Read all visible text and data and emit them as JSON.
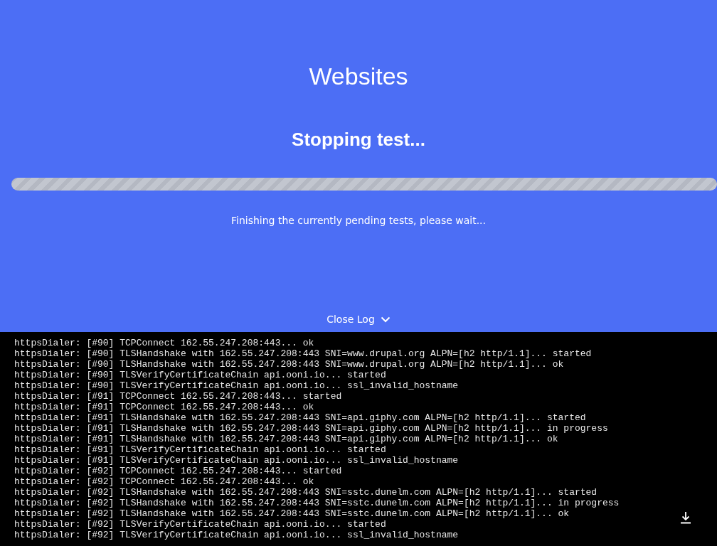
{
  "header": {
    "title": "Websites",
    "status": "Stopping test...",
    "message": "Finishing the currently pending tests, please wait...",
    "log_toggle": "Close Log",
    "progress": {
      "level": 1
    }
  },
  "log": {
    "lines": [
      "httpsDialer: [#90] TCPConnect 162.55.247.208:443... ok",
      "httpsDialer: [#90] TLSHandshake with 162.55.247.208:443 SNI=www.drupal.org ALPN=[h2 http/1.1]... started",
      "httpsDialer: [#90] TLSHandshake with 162.55.247.208:443 SNI=www.drupal.org ALPN=[h2 http/1.1]... ok",
      "httpsDialer: [#90] TLSVerifyCertificateChain api.ooni.io... started",
      "httpsDialer: [#90] TLSVerifyCertificateChain api.ooni.io... ssl_invalid_hostname",
      "httpsDialer: [#91] TCPConnect 162.55.247.208:443... started",
      "httpsDialer: [#91] TCPConnect 162.55.247.208:443... ok",
      "httpsDialer: [#91] TLSHandshake with 162.55.247.208:443 SNI=api.giphy.com ALPN=[h2 http/1.1]... started",
      "httpsDialer: [#91] TLSHandshake with 162.55.247.208:443 SNI=api.giphy.com ALPN=[h2 http/1.1]... in progress",
      "httpsDialer: [#91] TLSHandshake with 162.55.247.208:443 SNI=api.giphy.com ALPN=[h2 http/1.1]... ok",
      "httpsDialer: [#91] TLSVerifyCertificateChain api.ooni.io... started",
      "httpsDialer: [#91] TLSVerifyCertificateChain api.ooni.io... ssl_invalid_hostname",
      "httpsDialer: [#92] TCPConnect 162.55.247.208:443... started",
      "httpsDialer: [#92] TCPConnect 162.55.247.208:443... ok",
      "httpsDialer: [#92] TLSHandshake with 162.55.247.208:443 SNI=sstc.dunelm.com ALPN=[h2 http/1.1]... started",
      "httpsDialer: [#92] TLSHandshake with 162.55.247.208:443 SNI=sstc.dunelm.com ALPN=[h2 http/1.1]... in progress",
      "httpsDialer: [#92] TLSHandshake with 162.55.247.208:443 SNI=sstc.dunelm.com ALPN=[h2 http/1.1]... ok",
      "httpsDialer: [#92] TLSVerifyCertificateChain api.ooni.io... started",
      "httpsDialer: [#92] TLSVerifyCertificateChain api.ooni.io... ssl_invalid_hostname"
    ]
  }
}
